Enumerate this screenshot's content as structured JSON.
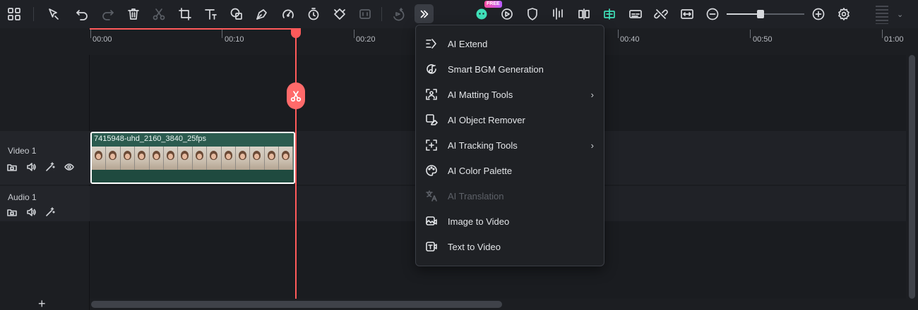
{
  "toolbar": {
    "free_badge": "FREE",
    "zoom_level": 0.44
  },
  "ruler": {
    "ticks": [
      "00:00",
      "00:10",
      "00:20",
      "00:40",
      "00:50",
      "01:00"
    ]
  },
  "tracks": {
    "video": {
      "name": "Video 1"
    },
    "audio": {
      "name": "Audio 1"
    }
  },
  "clip": {
    "title": "7415948-uhd_2160_3840_25fps",
    "thumb_count": 14
  },
  "more_menu": {
    "items": [
      {
        "label": "AI Extend",
        "icon": "ai-extend-icon",
        "submenu": false,
        "disabled": false
      },
      {
        "label": "Smart BGM Generation",
        "icon": "music-note-icon",
        "submenu": false,
        "disabled": false
      },
      {
        "label": "AI Matting Tools",
        "icon": "person-frame-icon",
        "submenu": true,
        "disabled": false
      },
      {
        "label": "AI Object Remover",
        "icon": "eraser-icon",
        "submenu": false,
        "disabled": false
      },
      {
        "label": "AI Tracking Tools",
        "icon": "tracking-icon",
        "submenu": true,
        "disabled": false
      },
      {
        "label": "AI Color Palette",
        "icon": "palette-icon",
        "submenu": false,
        "disabled": false
      },
      {
        "label": "AI Translation",
        "icon": "translate-icon",
        "submenu": false,
        "disabled": true
      },
      {
        "label": "Image to Video",
        "icon": "image-video-icon",
        "submenu": false,
        "disabled": false
      },
      {
        "label": "Text to Video",
        "icon": "text-video-icon",
        "submenu": false,
        "disabled": false
      }
    ],
    "submenu_arrow": "›"
  },
  "add_track_label": "+",
  "caret": "⌄",
  "colors": {
    "playhead": "#ff5a5a",
    "accent": "#3fe0b8",
    "clip_bg": "#2b5b4f"
  }
}
